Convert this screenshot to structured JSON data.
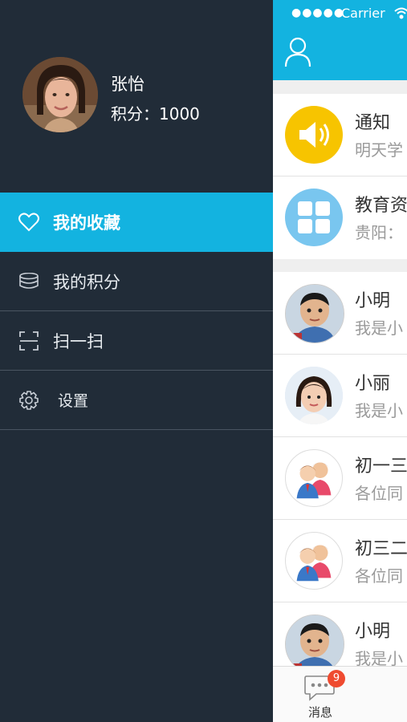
{
  "status_bar": {
    "signal": "●●●●●",
    "carrier": "Carrier"
  },
  "profile": {
    "name": "张怡",
    "points": "积分：1000"
  },
  "menu": [
    {
      "label": "我的收藏",
      "icon": "heart-icon",
      "active": true
    },
    {
      "label": "我的积分",
      "icon": "coins-icon",
      "active": false
    },
    {
      "label": "扫一扫",
      "icon": "scan-icon",
      "active": false
    },
    {
      "label": "设置",
      "icon": "gear-icon",
      "active": false
    }
  ],
  "messages": [
    {
      "title": "通知",
      "subtitle": "明天学",
      "avatar": "speaker-icon"
    },
    {
      "title": "教育资",
      "subtitle": "贵阳：",
      "avatar": "grid-icon"
    },
    {
      "title": "小明",
      "subtitle": "我是小",
      "avatar": "boy-photo"
    },
    {
      "title": "小丽",
      "subtitle": "我是小",
      "avatar": "girl-photo"
    },
    {
      "title": "初一三",
      "subtitle": "各位同",
      "avatar": "group-icon"
    },
    {
      "title": "初三二",
      "subtitle": "各位同",
      "avatar": "group-icon"
    },
    {
      "title": "小明",
      "subtitle": "我是小",
      "avatar": "boy-photo"
    }
  ],
  "tabbar": {
    "messages_label": "消息",
    "badge": "9"
  },
  "colors": {
    "accent": "#13b3e0",
    "drawer_bg": "#212c38",
    "badge": "#ef4b30",
    "notice_icon_bg": "#f7c400",
    "edu_icon_bg": "#79c6ef"
  }
}
